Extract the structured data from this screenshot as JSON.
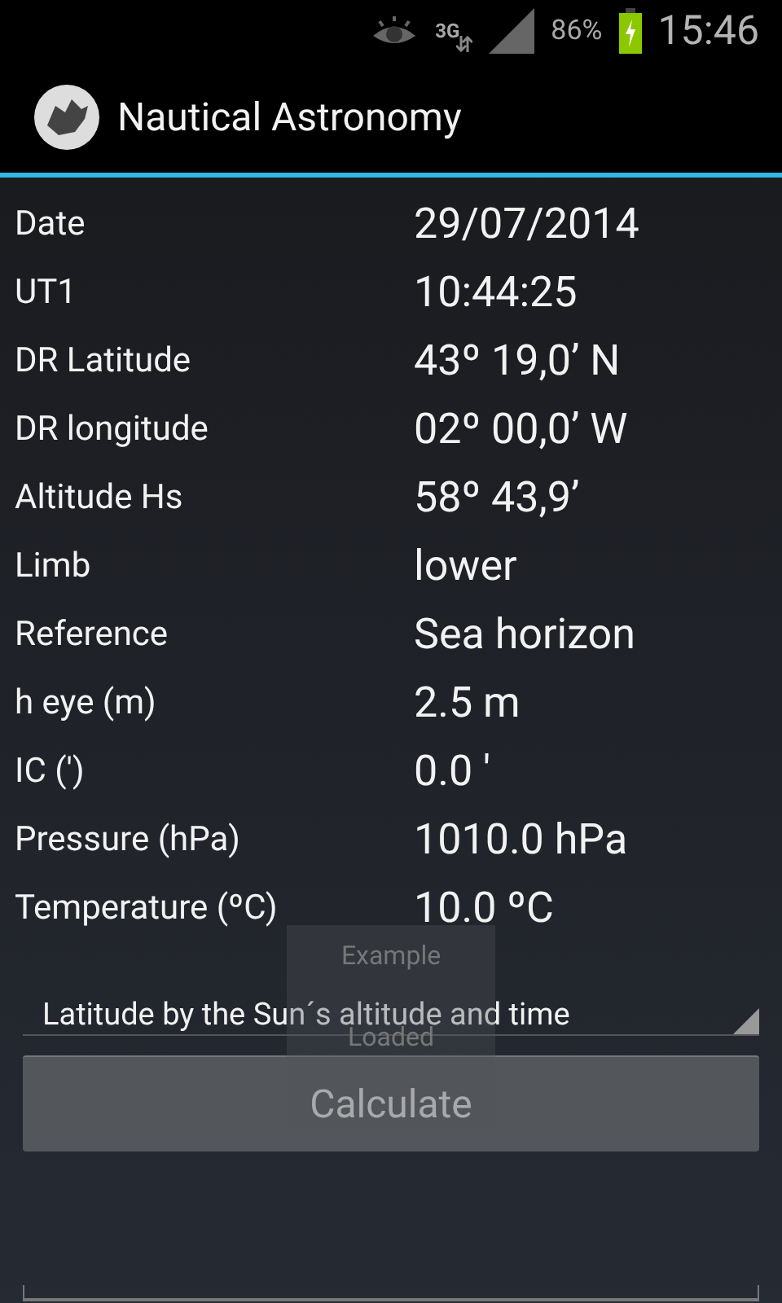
{
  "status_bar": {
    "network": "3G",
    "battery": "86%",
    "time": "15:46"
  },
  "app_bar": {
    "title": "Nautical Astronomy"
  },
  "fields": [
    {
      "label": "Date",
      "value": "29/07/2014"
    },
    {
      "label": "UT1",
      "value": "10:44:25"
    },
    {
      "label": "DR Latitude",
      "value": "43º 19,0’ N"
    },
    {
      "label": "DR longitude",
      "value": "02º 00,0’ W"
    },
    {
      "label": "Altitude Hs",
      "value": "58º 43,9’"
    },
    {
      "label": "Limb",
      "value": "lower"
    },
    {
      "label": "Reference",
      "value": "Sea horizon"
    },
    {
      "label": "h eye (m)",
      "value": "2.5 m"
    },
    {
      "label": "IC (')",
      "value": "0.0 '"
    },
    {
      "label": "Pressure (hPa)",
      "value": "1010.0 hPa"
    },
    {
      "label": "Temperature (ºC)",
      "value": "10.0 ºC"
    }
  ],
  "method_dropdown": {
    "value": "Latitude by the Sun´s altitude and time"
  },
  "calculate_button": {
    "label": "Calculate"
  },
  "toast": {
    "lines": [
      "Example",
      "Loaded"
    ]
  }
}
